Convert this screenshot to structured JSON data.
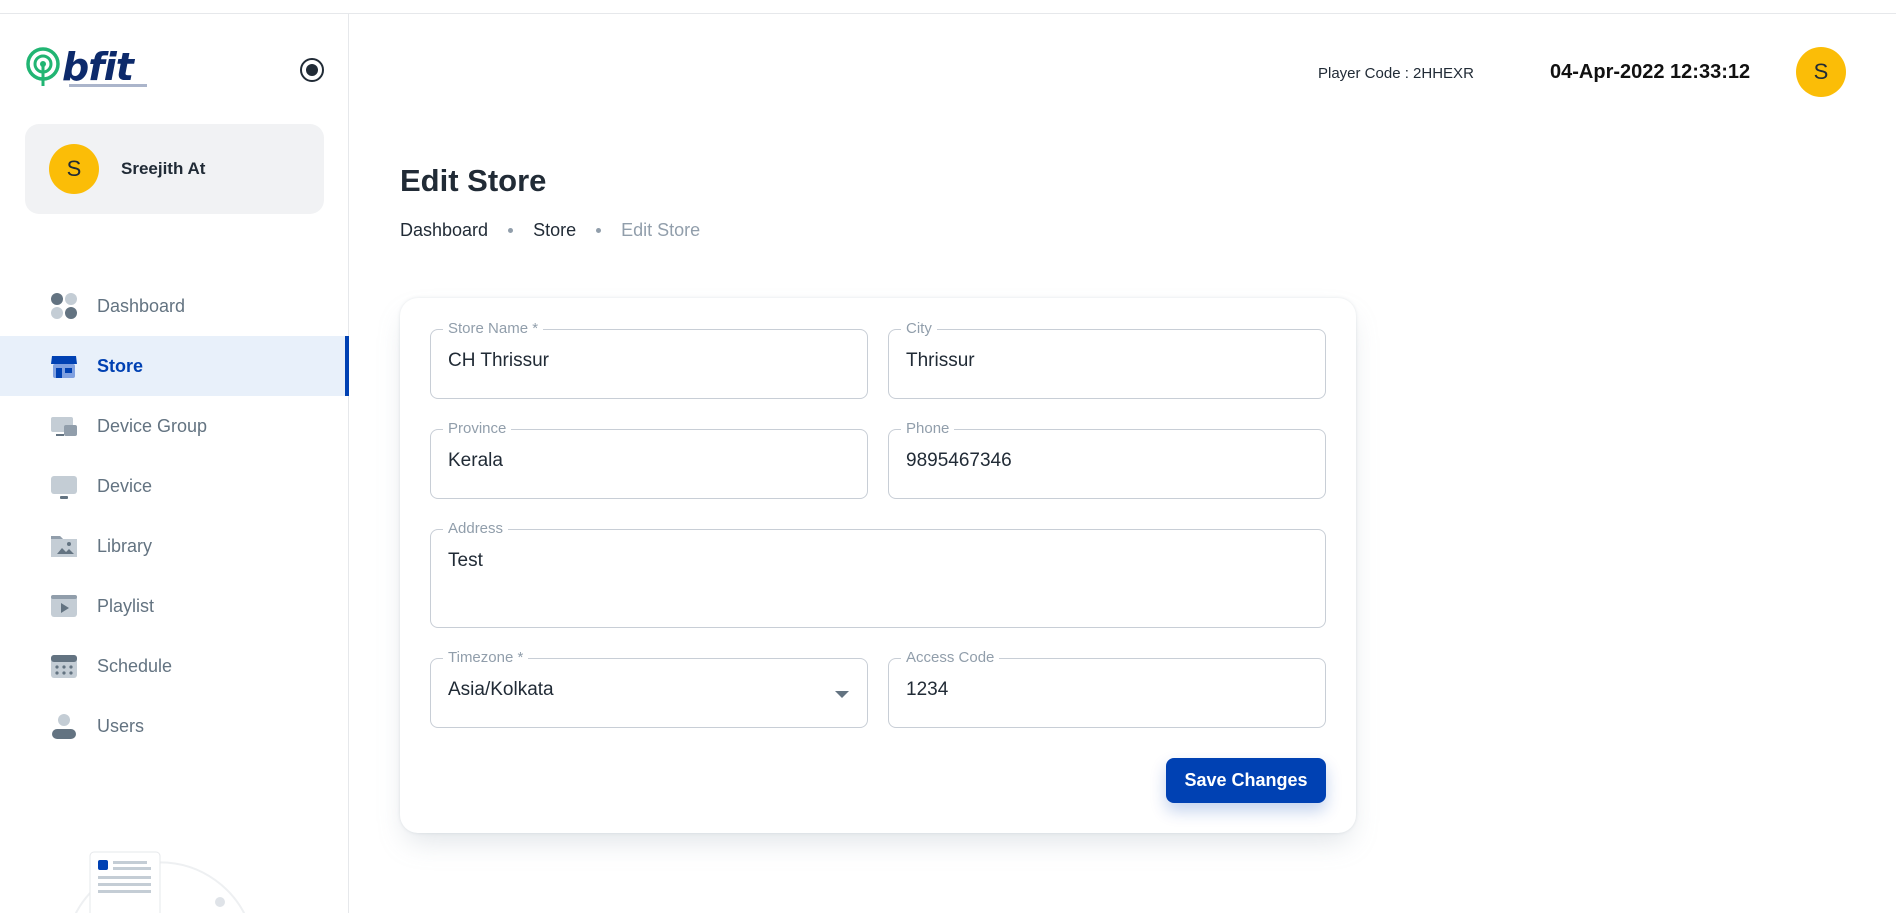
{
  "brand": {
    "logo_text": "bfit"
  },
  "sidebar": {
    "user": {
      "initial": "S",
      "name": "Sreejith At"
    },
    "items": [
      {
        "label": "Dashboard",
        "icon": "dashboard-icon",
        "active": false
      },
      {
        "label": "Store",
        "icon": "store-icon",
        "active": true
      },
      {
        "label": "Device Group",
        "icon": "device-group-icon",
        "active": false
      },
      {
        "label": "Device",
        "icon": "device-icon",
        "active": false
      },
      {
        "label": "Library",
        "icon": "library-icon",
        "active": false
      },
      {
        "label": "Playlist",
        "icon": "playlist-icon",
        "active": false
      },
      {
        "label": "Schedule",
        "icon": "schedule-icon",
        "active": false
      },
      {
        "label": "Users",
        "icon": "users-icon",
        "active": false
      }
    ]
  },
  "header": {
    "player_code": "Player Code : 2HHEXR",
    "datetime": "04-Apr-2022 12:33:12",
    "avatar_initial": "S"
  },
  "page": {
    "title": "Edit Store",
    "breadcrumb": [
      "Dashboard",
      "Store",
      "Edit Store"
    ]
  },
  "form": {
    "store_name": {
      "label": "Store Name *",
      "value": "CH Thrissur"
    },
    "city": {
      "label": "City",
      "value": "Thrissur"
    },
    "province": {
      "label": "Province",
      "value": "Kerala"
    },
    "phone": {
      "label": "Phone",
      "value": "9895467346"
    },
    "address": {
      "label": "Address",
      "value": "Test"
    },
    "timezone": {
      "label": "Timezone *",
      "value": "Asia/Kolkata"
    },
    "access_code": {
      "label": "Access Code",
      "value": "1234"
    },
    "save_label": "Save Changes"
  },
  "colors": {
    "primary": "#0041b3",
    "avatar": "#fbbd07",
    "active_bg": "#e8f0fa",
    "logo_green": "#21b573",
    "logo_navy": "#0d2a6b"
  }
}
